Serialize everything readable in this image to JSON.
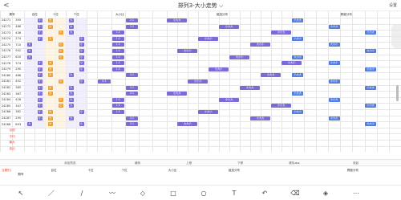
{
  "header": {
    "back_label": "<",
    "title": "排列3-大小走势 ⌵",
    "settings_label": "设置"
  },
  "col_headers": [
    "期号",
    "奖号",
    "大",
    "小",
    "大",
    "小",
    "大",
    "小",
    "0:3",
    "1:2",
    "2:1",
    "3:0",
    "组选分布",
    "",
    "",
    "",
    "",
    "",
    "",
    "",
    "",
    "",
    "",
    "",
    "",
    "",
    "大小分布",
    "",
    "",
    "",
    "",
    "",
    "",
    "",
    ""
  ],
  "section_headers": {
    "issue": "期号",
    "bai": "百位",
    "shi": "十位",
    "ge": "个位",
    "bili": "大小比",
    "zuxuan": "组选分布",
    "daxiao": "形态分布",
    "fenbu": "跨度分布"
  },
  "issues": [
    "24271",
    "24272",
    "24273",
    "24274",
    "24275",
    "24276",
    "24277",
    "24278",
    "24279",
    "24280",
    "24281",
    "24282",
    "24283",
    "24284",
    "24285",
    "24286",
    "24287",
    "24288"
  ],
  "numbers": [
    "395",
    "486",
    "436",
    "274",
    "710",
    "902",
    "620",
    "374",
    "290",
    "468",
    "402",
    "385",
    "367",
    "428",
    "347",
    "362",
    "295",
    "893"
  ],
  "stat_rows": [
    "出现",
    "平均",
    "最大",
    "连出"
  ],
  "midbar": [
    "添加预选",
    "横条",
    "上移",
    "下移",
    "清除◄ ►",
    "收起"
  ],
  "bottom_head": {
    "issue": "期号",
    "c1": "百位",
    "c2": "十位",
    "c3": "个位",
    "c4": "大小比",
    "c5": "组选分布",
    "c6": "形态分布",
    "c7": "跨度分布",
    "label": "当期形态"
  },
  "pill_labels": {
    "a": "1:2",
    "b": "2:1",
    "c": "3:0",
    "d": "大大大",
    "e": "大大小",
    "f": "大小大",
    "g": "小大大",
    "h": "小小大",
    "i": "小小小",
    "j": "重大",
    "k": "0:3"
  },
  "tools": [
    "pointer-icon",
    "pen-icon",
    "pencil-icon",
    "highlighter-icon",
    "eraser-icon",
    "rect-icon",
    "circle-icon",
    "text-icon",
    "undo-icon",
    "redo-icon",
    "clear-icon",
    "more-icon"
  ],
  "colors": {
    "purple": "#7b6bd6",
    "orange": "#f0a030",
    "red": "#e9483b",
    "blue": "#4f7be0",
    "lightpurple": "#ece8fb",
    "lightorange": "#fdf0d9",
    "lightpink": "#fde5e5",
    "green": "#6cc07a"
  }
}
